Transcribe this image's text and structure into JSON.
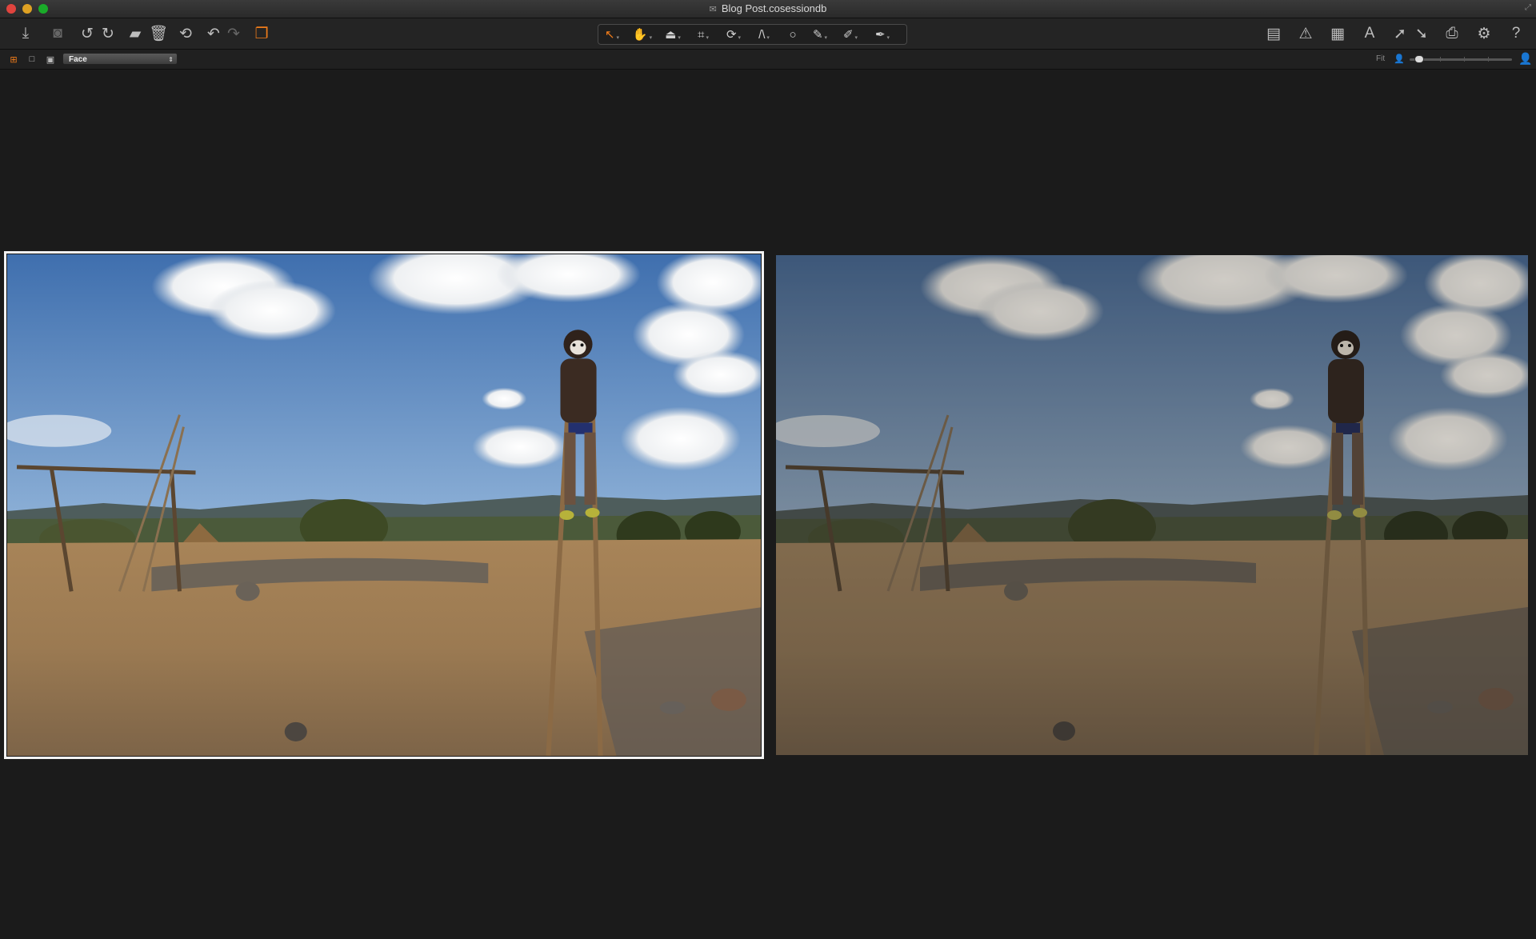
{
  "window": {
    "title": "Blog Post.cosessiondb"
  },
  "toolbar": {
    "left_icons": [
      "import-icon",
      "camera-icon",
      "rotate-left-icon",
      "rotate-right-icon",
      "move-to-folder-icon",
      "trash-icon",
      "revert-icon",
      "undo-icon",
      "redo-icon",
      "multi-view-icon"
    ],
    "cursor_tools": [
      "select-tool-icon",
      "pan-tool-icon",
      "loupe-tool-icon",
      "crop-tool-icon",
      "rotate-tool-icon",
      "keystone-tool-icon",
      "spot-removal-tool-icon",
      "brush-tool-icon",
      "mask-tool-icon",
      "picker-tool-icon"
    ],
    "right_icons": [
      "viewer-layout-icon",
      "exposure-warning-icon",
      "grid-icon",
      "text-overlay-icon",
      "export-icon",
      "import-arrow-icon",
      "print-icon",
      "settings-icon",
      "help-icon"
    ]
  },
  "viewer_bar": {
    "selected_mode": "Face",
    "zoom_label": "Fit",
    "zoom_level": 0.05
  },
  "photos": [
    {
      "name": "variant-original",
      "selected": true
    },
    {
      "name": "variant-adjusted",
      "selected": false
    }
  ]
}
